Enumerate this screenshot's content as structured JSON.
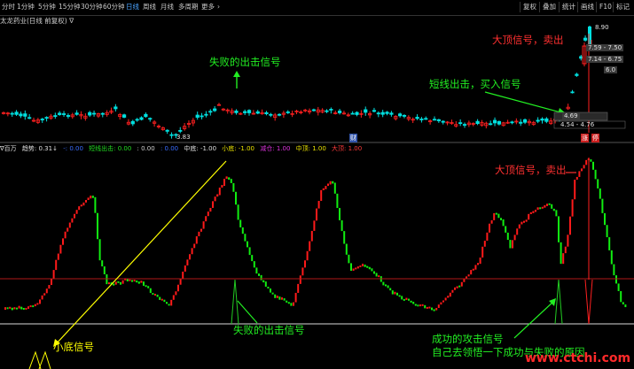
{
  "toolbar": {
    "periods": [
      {
        "label": "分时",
        "active": false
      },
      {
        "label": "1分钟",
        "active": false
      },
      {
        "label": "5分钟",
        "active": false
      },
      {
        "label": "15分钟",
        "active": false
      },
      {
        "label": "30分钟",
        "active": false
      },
      {
        "label": "60分钟",
        "active": false
      },
      {
        "label": "日线",
        "active": true
      },
      {
        "label": "周线",
        "active": false
      },
      {
        "label": "月线",
        "active": false
      },
      {
        "label": "多周期",
        "active": false
      },
      {
        "label": "更多",
        "active": false
      }
    ],
    "right_buttons": [
      "复权",
      "叠加",
      "统计",
      "画线",
      "F10",
      "标记"
    ]
  },
  "chart_title": "太龙药业(日线 前复权) ∇",
  "price_labels": {
    "high": "8.90",
    "low": "3.83",
    "range1": "7.59 - 7.50",
    "range2": "7.14 - 6.75",
    "range3": "4.54 - 4.76",
    "axis1": "4.69",
    "axis2": "6.0"
  },
  "bottom_markers": {
    "left_label": "财",
    "limit_up": "涨",
    "limit_down": "停"
  },
  "indicator": {
    "name": "∇百万",
    "items": [
      {
        "text": "趋势: 0.31↓",
        "color": "#e0e0e0"
      },
      {
        "text": "-: 0.00",
        "color": "#3a6dff"
      },
      {
        "text": "短线出击: 0.00",
        "color": "#22dd22"
      },
      {
        "text": ": 0.00",
        "color": "#cfcfcf"
      },
      {
        "text": ": 0.00",
        "color": "#3a6dff"
      },
      {
        "text": "中底: -1.00",
        "color": "#e0e0e0"
      },
      {
        "text": "小底: -1.00",
        "color": "#e8e000"
      },
      {
        "text": "减仓: 1.00",
        "color": "#dd33dd"
      },
      {
        "text": "中顶: 1.00",
        "color": "#e8e000"
      },
      {
        "text": "大顶: 1.00",
        "color": "#ff3b3b"
      }
    ]
  },
  "annotations": {
    "fail_signal_top": "失败的出击信号",
    "top_signal_top": "大顶信号，卖出",
    "short_attack_top": "短线出击，买入信号",
    "top_signal_bottom": "大顶信号，卖出",
    "fail_signal_bottom": "失败的出击信号",
    "bottom_signal": "小底信号",
    "success_signal": "成功的攻击信号",
    "success_note": "自己去领悟一下成功与失败的原因",
    "watermark": "www.ctchi.com"
  },
  "colors": {
    "up": "#ff2020",
    "down": "#00e0e0",
    "osc_up": "#ff1a1a",
    "osc_down": "#11ee11",
    "annotation_green": "#22ee22",
    "annotation_red": "#ff3030",
    "annotation_yellow": "#ffff00",
    "band_red": "#b01818",
    "band_white": "#d8d8d8"
  }
}
